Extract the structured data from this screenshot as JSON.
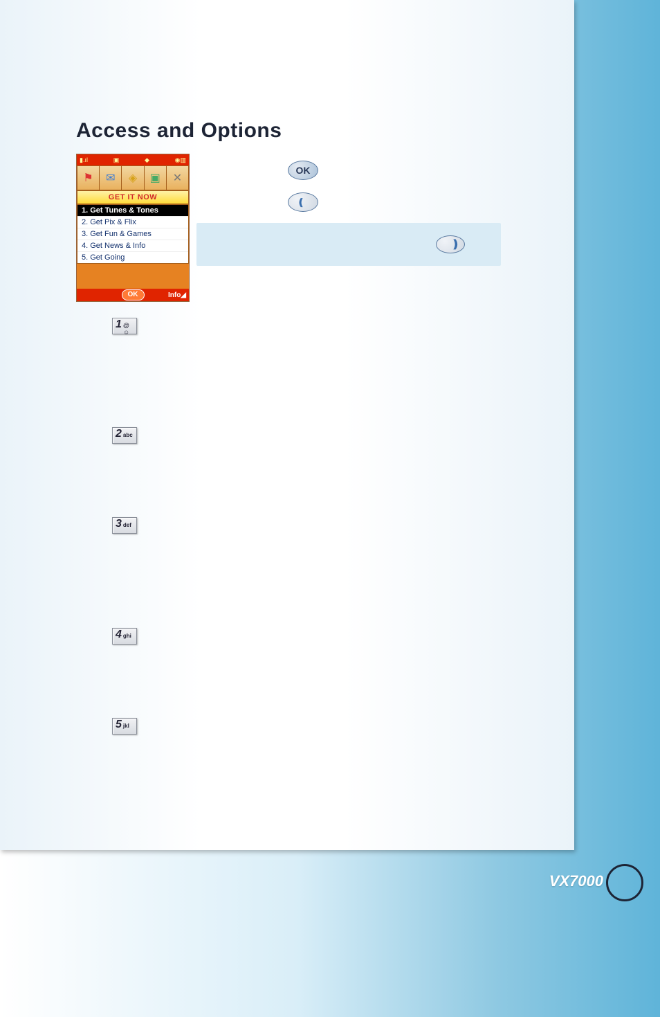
{
  "heading": "Access and Options",
  "phone": {
    "banner": "GET IT NOW",
    "menu": [
      "1.  Get Tunes & Tones",
      "2.  Get Pix & Flix",
      "3.  Get Fun & Games",
      "4.  Get News & Info",
      "5.  Get Going"
    ],
    "soft_ok": "OK",
    "soft_info": "Info◢",
    "status": {
      "signal": "▮.ıl",
      "camera": "▣",
      "diamond": "◆",
      "battery": "◉▥"
    },
    "icons": [
      "⚑",
      "✉",
      "◈",
      "▣",
      "✕"
    ]
  },
  "ok_label": "OK",
  "open_chevron": "❪",
  "note_chevron": "❫",
  "keys": [
    {
      "num": "1",
      "txt": "",
      "sym": "@ ☺"
    },
    {
      "num": "2",
      "txt": "abc",
      "sym": ""
    },
    {
      "num": "3",
      "txt": "def",
      "sym": ""
    },
    {
      "num": "4",
      "txt": "ghi",
      "sym": ""
    },
    {
      "num": "5",
      "txt": "jkl",
      "sym": ""
    }
  ],
  "footer": {
    "model": "VX7000"
  }
}
